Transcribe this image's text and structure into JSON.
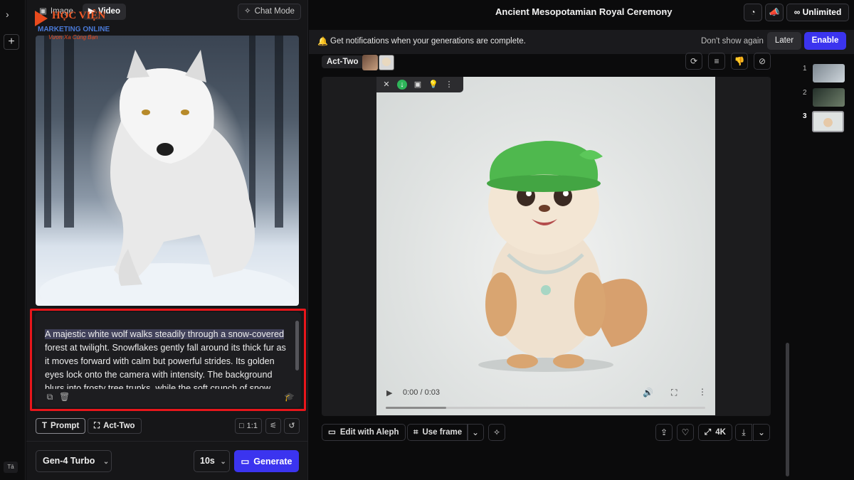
{
  "mode_tabs": {
    "image": "Image",
    "video": "Video"
  },
  "chat_mode": "Chat Mode",
  "logo": {
    "name": "HỌC VIỆN",
    "sub": "MARKETING ONLINE",
    "tagline": "Vươn Xa Cùng Bạn"
  },
  "project_title": "Ancient Mesopotamian Royal Ceremony",
  "title_more": "···",
  "top_actions": {
    "unlimited": "Unlimited"
  },
  "notification": {
    "text": "Get notifications when your generations are complete.",
    "dont_show": "Don't show again",
    "later": "Later",
    "enable": "Enable"
  },
  "prompt": {
    "highlighted": "A majestic white wolf walks steadily through a snow-covered",
    "rest": " forest at twilight. Snowflakes gently fall around its thick fur as it moves forward with calm but powerful strides. Its golden eyes lock onto the camera with intensity. The background blurs into frosty tree trunks, while the soft crunch of snow"
  },
  "chips": {
    "prompt": "Prompt",
    "act_two": "Act-Two",
    "ratio": "1:1"
  },
  "model": {
    "name": "Gen-4 Turbo"
  },
  "duration": "10s",
  "generate": "Generate",
  "viewer": {
    "tag": "Act-Two",
    "time": "0:00 / 0:03",
    "progress_fraction": 0.19
  },
  "viewer_actions": {
    "edit": "Edit with Aleph",
    "use_frame": "Use frame",
    "resolution": "4K"
  },
  "generations": [
    {
      "num": "1"
    },
    {
      "num": "2"
    },
    {
      "num": "3"
    }
  ],
  "rail": {
    "avatar": "Tā"
  },
  "colors": {
    "accent": "#3b34ef",
    "highlight_border": "#e8161b",
    "download_green": "#2fb55a"
  }
}
